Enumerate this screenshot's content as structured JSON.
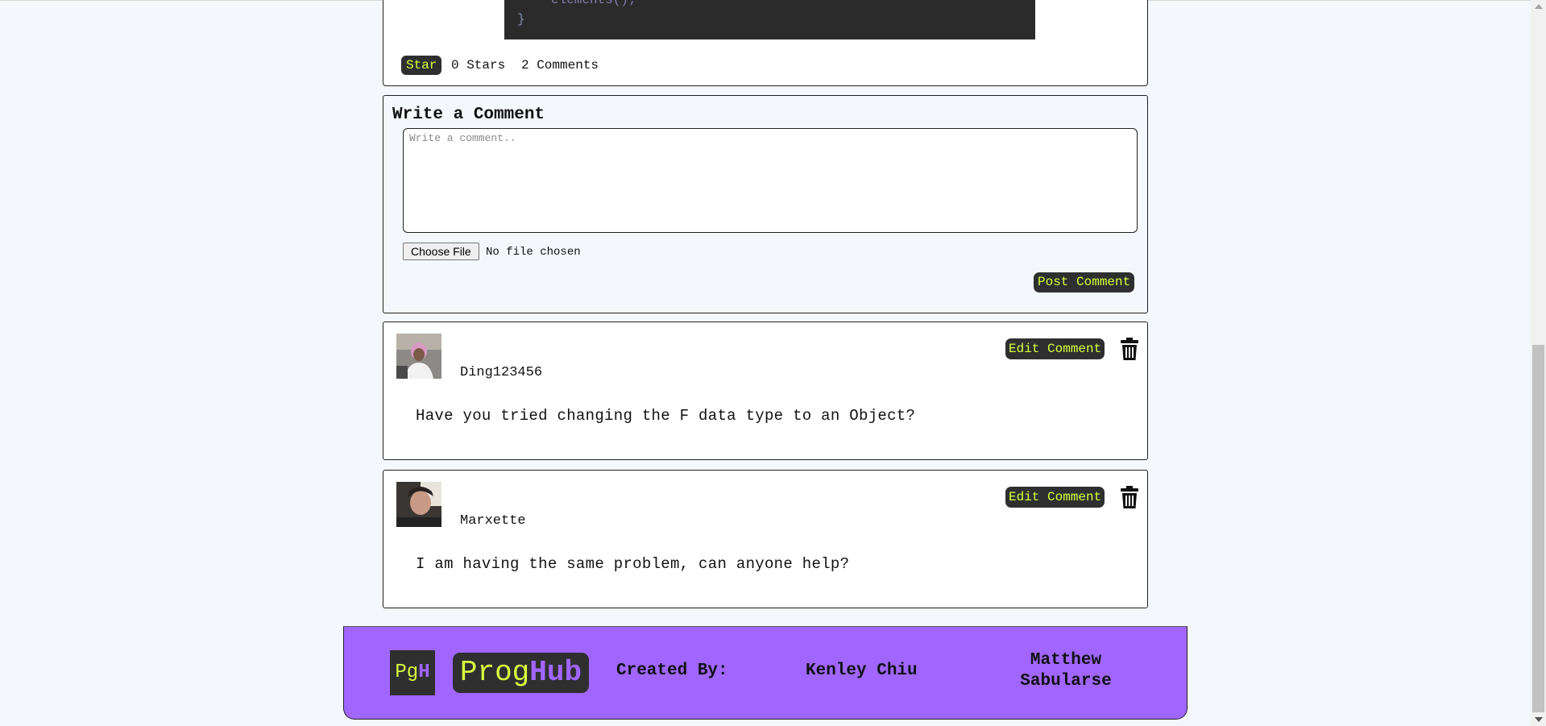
{
  "post": {
    "code_line_1": "elements();",
    "code_line_2": "}",
    "star_label": "Star",
    "stars_text": "0 Stars",
    "comments_text": "2 Comments"
  },
  "write_comment": {
    "title": "Write a Comment",
    "placeholder": "Write a comment..",
    "file_button": "Choose File",
    "file_status": "No file chosen",
    "post_button": "Post Comment"
  },
  "comments": [
    {
      "username": "Ding123456",
      "text": "Have you tried changing the F data type to an Object?",
      "edit_label": "Edit Comment"
    },
    {
      "username": "Marxette",
      "text": "I am having the same problem, can anyone help?",
      "edit_label": "Edit Comment"
    }
  ],
  "footer": {
    "logo_small_pg": "Pg",
    "logo_small_h": "H",
    "logo_prog": "Prog",
    "logo_hub": "Hub",
    "created_by": "Created By:",
    "author_1": "Kenley Chiu",
    "author_2": "Matthew Sabularse"
  },
  "colors": {
    "accent": "#a066ff",
    "button_bg": "#2f2f2f",
    "button_text": "#d7ff3f",
    "page_bg": "#f4f7fb"
  },
  "icons": [
    "trash-icon",
    "avatar"
  ]
}
